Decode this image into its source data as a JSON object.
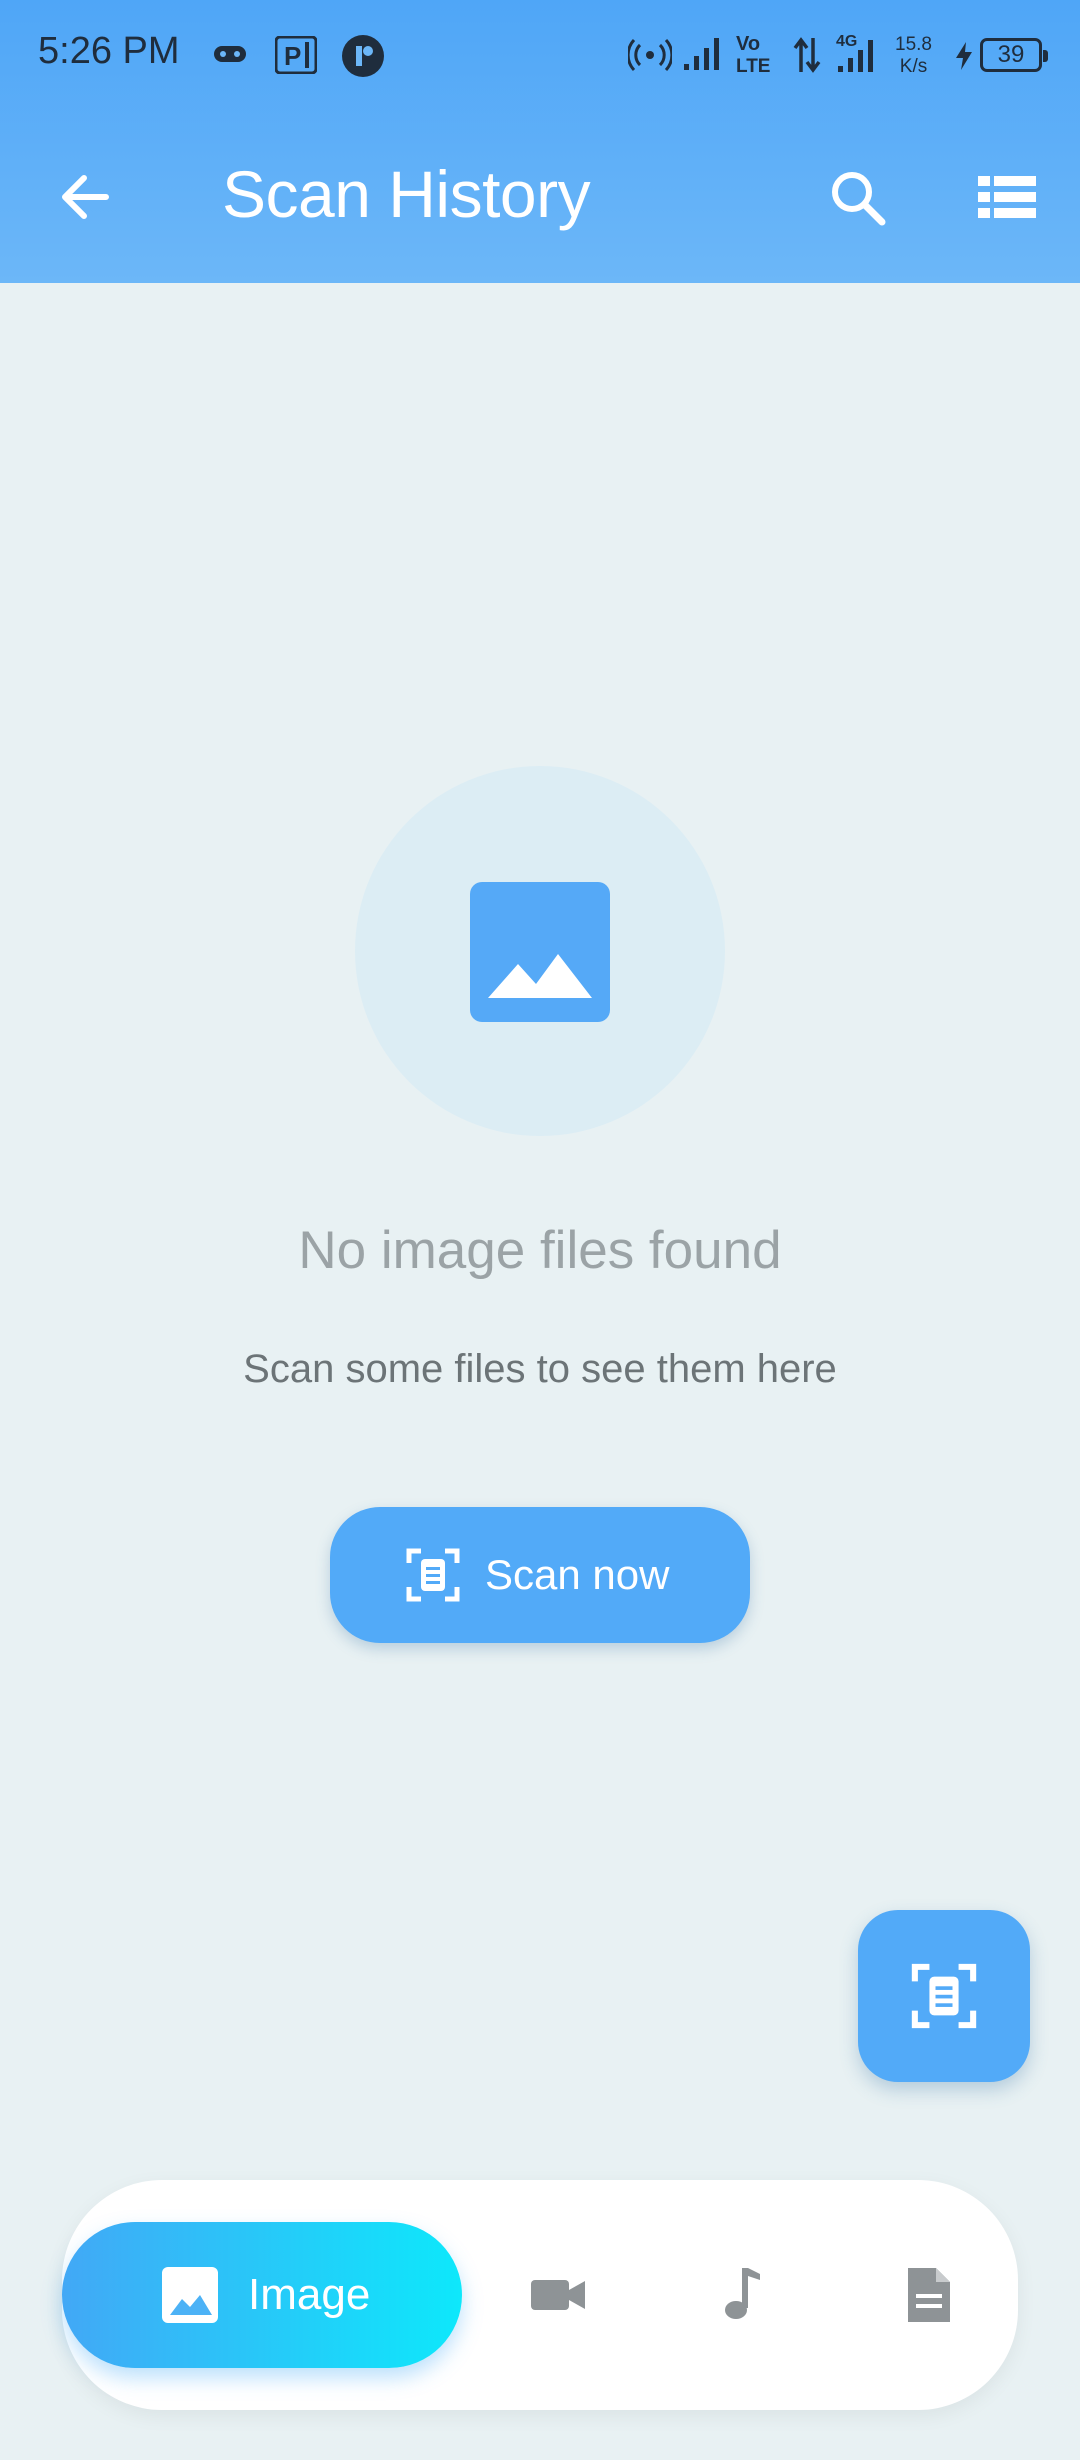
{
  "status_bar": {
    "time": "5:26 PM",
    "network_speed_value": "15.8",
    "network_speed_unit": "K/s",
    "battery_level": "39",
    "icons": [
      "game-controller-icon",
      "parking-app-icon",
      "app-logo-icon",
      "hotspot-icon",
      "signal-icon",
      "volte-icon",
      "data-transfer-icon",
      "signal-4g-icon",
      "charging-icon",
      "battery-icon"
    ]
  },
  "toolbar": {
    "title": "Scan History",
    "back_icon": "arrow-left-icon",
    "search_icon": "search-icon",
    "view_icon": "list-view-icon"
  },
  "empty_state": {
    "icon": "image-icon",
    "title": "No image files found",
    "subtitle": "Scan some files to see them here"
  },
  "scan_button": {
    "label": "Scan now",
    "icon": "scan-document-icon"
  },
  "fab": {
    "icon": "scan-document-icon"
  },
  "bottom_nav": {
    "items": [
      {
        "label": "Image",
        "icon": "image-icon",
        "active": true
      },
      {
        "label": "",
        "icon": "video-icon",
        "active": false
      },
      {
        "label": "",
        "icon": "music-note-icon",
        "active": false
      },
      {
        "label": "",
        "icon": "document-icon",
        "active": false
      }
    ]
  },
  "colors": {
    "header": "#4fa6f7",
    "accent": "#52aaf8",
    "background": "#e8f1f3",
    "active_tab_gradient_end": "#0de8fb"
  }
}
